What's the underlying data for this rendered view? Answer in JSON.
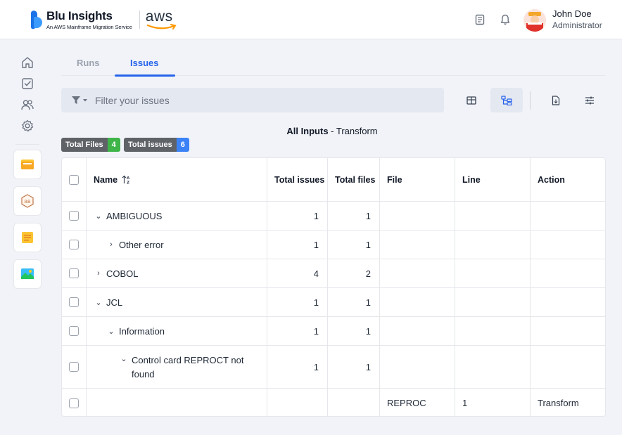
{
  "brand": {
    "name": "Blu Insights",
    "subtitle": "An AWS Mainframe Migration Service",
    "partner": "aws"
  },
  "user": {
    "name": "John Doe",
    "role": "Administrator"
  },
  "tabs": [
    {
      "label": "Runs"
    },
    {
      "label": "Issues"
    }
  ],
  "filter": {
    "placeholder": "Filter your issues"
  },
  "title": {
    "bold": "All Inputs",
    "rest": " - Transform"
  },
  "badges": [
    {
      "label": "Total Files",
      "count": "4"
    },
    {
      "label": "Total issues",
      "count": "6"
    }
  ],
  "table": {
    "headers": {
      "name": "Name",
      "total_issues": "Total issues",
      "total_files": "Total files",
      "file": "File",
      "line": "Line",
      "action": "Action"
    },
    "rows": [
      {
        "name": "AMBIGUOUS",
        "issues": "1",
        "files": "1",
        "file": "",
        "line": "",
        "action": ""
      },
      {
        "name": "Other error",
        "issues": "1",
        "files": "1",
        "file": "",
        "line": "",
        "action": ""
      },
      {
        "name": "COBOL",
        "issues": "4",
        "files": "2",
        "file": "",
        "line": "",
        "action": ""
      },
      {
        "name": "JCL",
        "issues": "1",
        "files": "1",
        "file": "",
        "line": "",
        "action": ""
      },
      {
        "name": "Information",
        "issues": "1",
        "files": "1",
        "file": "",
        "line": "",
        "action": ""
      },
      {
        "name": "Control card REPROCT not found",
        "issues": "1",
        "files": "1",
        "file": "",
        "line": "",
        "action": ""
      },
      {
        "name": "",
        "issues": "",
        "files": "",
        "file": "REPROC",
        "line": "1",
        "action": "Transform"
      }
    ]
  },
  "icons": {
    "nav": [
      "home-icon",
      "checklist-icon",
      "users-icon",
      "gear-icon"
    ],
    "apps": [
      "folder-app-icon",
      "codebase-app-icon",
      "notes-app-icon",
      "image-app-icon"
    ],
    "header": [
      "docs-icon",
      "bell-icon"
    ],
    "toolbar": [
      "table-view-icon",
      "tree-view-icon",
      "export-file-icon",
      "columns-settings-icon"
    ]
  },
  "colors": {
    "accent": "#2563eb",
    "badge_files": "#3fb549",
    "badge_issues": "#3b82f6"
  }
}
